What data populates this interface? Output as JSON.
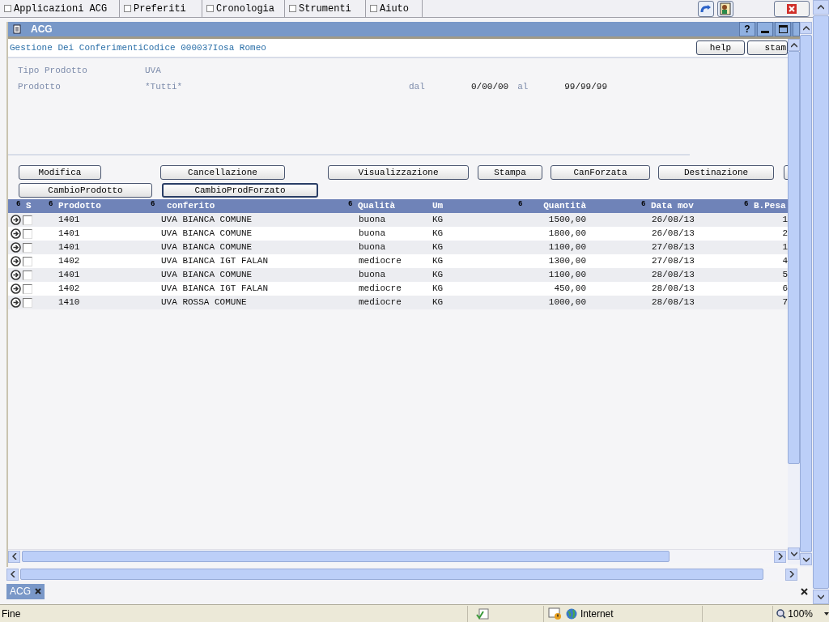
{
  "menu_bar": [
    {
      "label": "Applicazioni ACG"
    },
    {
      "label": "Preferiti"
    },
    {
      "label": "Cronologia"
    },
    {
      "label": "Strumenti"
    },
    {
      "label": "Aiuto"
    }
  ],
  "window": {
    "title": "ACG",
    "controls": [
      "?"
    ]
  },
  "header": {
    "title": "Gestione Dei ConferimentiCodice 000037Iosa Romeo",
    "buttons": [
      "help",
      "stam"
    ]
  },
  "form": {
    "tipo_label": "Tipo Prodotto",
    "tipo_value": "UVA",
    "prodotto_label": "Prodotto",
    "prodotto_value": "*Tutti*",
    "dal_label": "dal",
    "dal_value": "0/00/00",
    "al_label": "al",
    "al_value": "99/99/99"
  },
  "action_buttons": [
    [
      {
        "label": "Modifica",
        "focused": false
      },
      {
        "label": "Cancellazione",
        "focused": false
      },
      {
        "label": "Visualizzazione",
        "focused": false
      },
      {
        "label": "Stampa",
        "focused": false
      },
      {
        "label": "CanForzata",
        "focused": false
      },
      {
        "label": "Destinazione",
        "focused": false
      }
    ],
    [
      {
        "label": "CambioProdotto",
        "focused": false
      },
      {
        "label": "CambioProdForzato",
        "focused": true
      }
    ]
  ],
  "table": {
    "selection_column": {
      "label": "S",
      "sort_mark": "6"
    },
    "columns": [
      {
        "label": "Prodotto",
        "sort_mark": "6"
      },
      {
        "label": "conferito",
        "sort_mark": "6"
      },
      {
        "label": "Qualità",
        "sort_mark": "6"
      },
      {
        "label": "Um"
      },
      {
        "label": "Quantità",
        "sort_mark": "6"
      },
      {
        "label": "Data mov",
        "sort_mark": "6"
      },
      {
        "label": "B.Pesa",
        "sort_mark": "6"
      }
    ],
    "rows": [
      {
        "checked": false,
        "cells": [
          "1401",
          "UVA BIANCA COMUNE",
          "buona",
          "KG",
          "1500,00",
          "26/08/13",
          "1"
        ]
      },
      {
        "checked": false,
        "cells": [
          "1401",
          "UVA BIANCA COMUNE",
          "buona",
          "KG",
          "1800,00",
          "26/08/13",
          "2"
        ]
      },
      {
        "checked": false,
        "cells": [
          "1401",
          "UVA BIANCA COMUNE",
          "buona",
          "KG",
          "1100,00",
          "27/08/13",
          "1"
        ]
      },
      {
        "checked": false,
        "cells": [
          "1402",
          "UVA BIANCA IGT FALAN",
          "mediocre",
          "KG",
          "1300,00",
          "27/08/13",
          "4"
        ]
      },
      {
        "checked": false,
        "cells": [
          "1401",
          "UVA BIANCA COMUNE",
          "buona",
          "KG",
          "1100,00",
          "28/08/13",
          "5"
        ]
      },
      {
        "checked": false,
        "cells": [
          "1402",
          "UVA BIANCA IGT FALAN",
          "mediocre",
          "KG",
          "450,00",
          "28/08/13",
          "6"
        ]
      },
      {
        "checked": false,
        "cells": [
          "1410",
          "UVA ROSSA COMUNE",
          "mediocre",
          "KG",
          "1000,00",
          "28/08/13",
          "7"
        ]
      }
    ]
  },
  "tab_bar": {
    "tabs": [
      {
        "label": "ACG",
        "selected": true
      }
    ]
  },
  "status_bar": {
    "text": "Fine",
    "zone": "Internet",
    "zoom": "100%"
  }
}
